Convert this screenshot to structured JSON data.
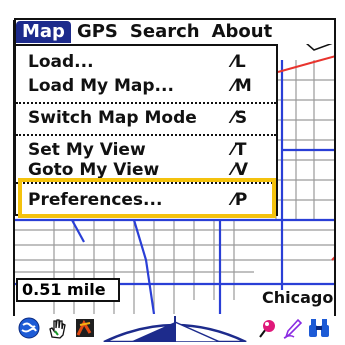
{
  "menubar": {
    "items": [
      {
        "label": "Map"
      },
      {
        "label": "GPS"
      },
      {
        "label": "Search"
      },
      {
        "label": "About"
      }
    ]
  },
  "menu": {
    "items": [
      {
        "label": "Load...",
        "shortcut": "⁄L"
      },
      {
        "label": "Load My Map...",
        "shortcut": "⁄M"
      },
      {
        "label": "Switch Map Mode",
        "shortcut": "⁄S"
      },
      {
        "label": "Set My View",
        "shortcut": "⁄T"
      },
      {
        "label": "Goto My View",
        "shortcut": "⁄V"
      },
      {
        "label": "Preferences...",
        "shortcut": "⁄P"
      }
    ]
  },
  "map": {
    "scale_label": "0.51 mile",
    "city_label": "Chicago"
  },
  "toolbar": {
    "icons": [
      "globe-icon",
      "hand-icon",
      "map-icon",
      "compass-icon",
      "pin-icon",
      "pen-icon",
      "binoculars-icon"
    ]
  },
  "colors": {
    "accent": "#1d2b8c",
    "highlight": "#f4c20d",
    "road_blue": "#2a3fd6",
    "road_red": "#e8342e",
    "street_gray": "#9a9a9a"
  }
}
